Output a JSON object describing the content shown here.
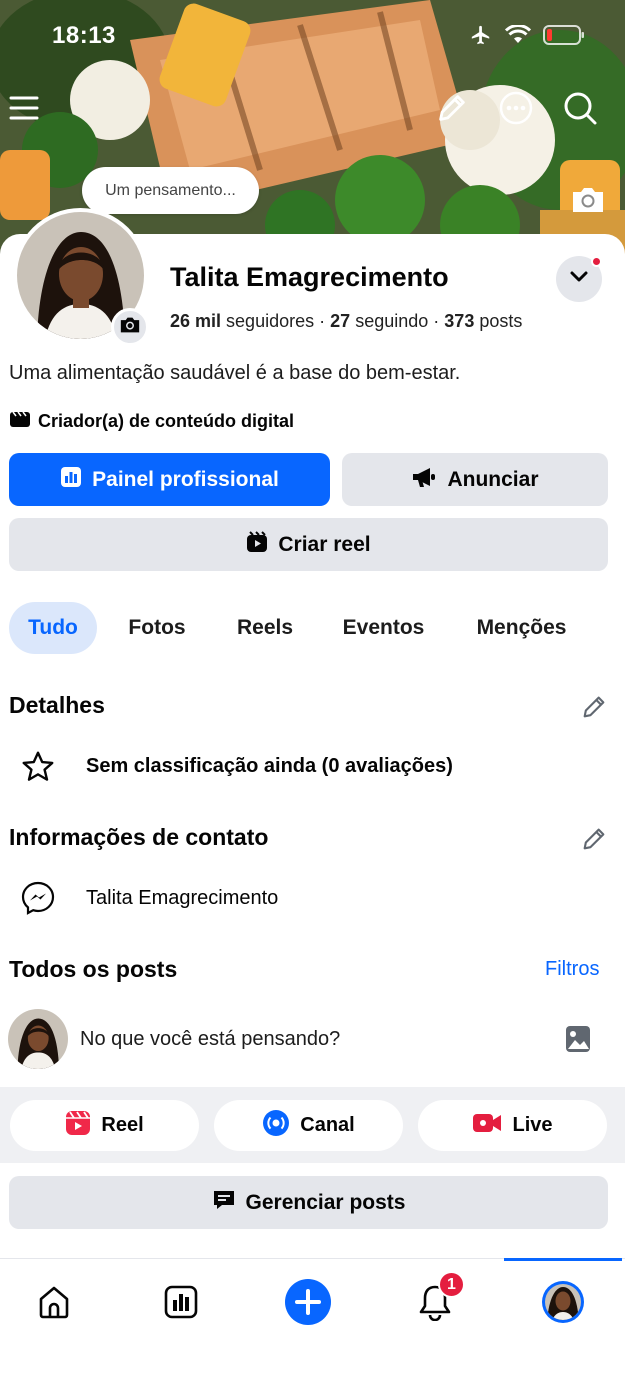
{
  "status_bar": {
    "time": "18:13"
  },
  "cover": {
    "thought_placeholder": "Um pensamento...",
    "icons": [
      "menu-icon",
      "pencil-icon",
      "more-icon",
      "search-icon",
      "camera-icon"
    ]
  },
  "profile": {
    "name": "Talita Emagrecimento",
    "followers_count": "26 mil",
    "followers_label": "seguidores",
    "following_count": "27",
    "following_label": "seguindo",
    "posts_count": "373",
    "posts_label": "posts",
    "separator": "·",
    "bio": "Uma alimentação saudável é a base do bem-estar.",
    "category": "Criador(a) de conteúdo digital"
  },
  "buttons": {
    "professional_dashboard": "Painel profissional",
    "advertise": "Anunciar",
    "create_reel": "Criar reel"
  },
  "tabs": [
    {
      "label": "Tudo",
      "active": true
    },
    {
      "label": "Fotos"
    },
    {
      "label": "Reels"
    },
    {
      "label": "Eventos"
    },
    {
      "label": "Menções"
    }
  ],
  "details": {
    "title": "Detalhes",
    "rating": "Sem classificação ainda (0 avaliações)"
  },
  "contact": {
    "title": "Informações de contato",
    "messenger": "Talita Emagrecimento"
  },
  "posts": {
    "title": "Todos os posts",
    "filters": "Filtros",
    "composer_placeholder": "No que você está pensando?",
    "actions": [
      "Reel",
      "Canal",
      "Live"
    ],
    "manage": "Gerenciar posts"
  },
  "bottom_nav": {
    "items": [
      "home-icon",
      "dashboard-icon",
      "create-icon",
      "notifications-icon",
      "profile-icon"
    ],
    "notifications_badge": "1"
  },
  "colors": {
    "primary": "#0866ff",
    "button_gray": "#e4e6eb",
    "badge_red": "#e41e3f",
    "tab_active_bg": "#dbe7fb"
  }
}
